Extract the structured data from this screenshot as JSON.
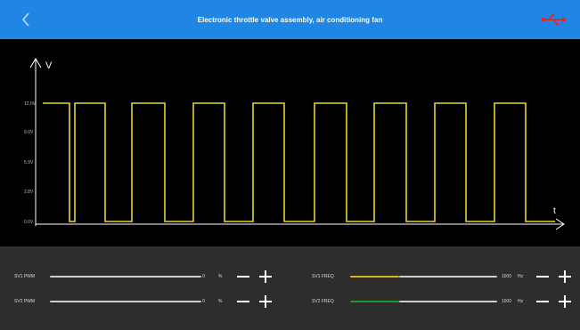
{
  "header": {
    "title": "Electronic throttle valve assembly, air conditioning fan"
  },
  "icons": {
    "back": "chevron-left-icon",
    "usb": "usb-icon"
  },
  "colors": {
    "header": "#1f86e3",
    "waveform": "#e6d52a",
    "sv2_freq_track": "#1e9a2a"
  },
  "chart_data": {
    "type": "line",
    "title": "",
    "xlabel": "t",
    "ylabel": "V",
    "y_ticks": [
      "0.0V",
      "2.8V",
      "5.9V",
      "9.0V",
      "12.0V"
    ],
    "ylim": [
      0,
      12
    ],
    "grid": false,
    "series": [
      {
        "values_description": "square wave toggling between 0 and 12 V, 9 high pulses",
        "x": [
          0,
          30,
          30,
          36,
          36,
          70,
          70,
          100,
          100,
          137,
          137,
          169,
          169,
          204,
          204,
          236,
          236,
          271,
          271,
          305,
          305,
          341,
          341,
          372,
          372,
          408,
          408,
          440,
          440,
          475,
          475,
          507,
          507,
          542,
          542,
          575
        ],
        "y": [
          12,
          12,
          0,
          0,
          12,
          12,
          0,
          0,
          12,
          12,
          0,
          0,
          12,
          12,
          0,
          0,
          12,
          12,
          0,
          0,
          12,
          12,
          0,
          0,
          12,
          12,
          0,
          0,
          12,
          12,
          0,
          0,
          12,
          12,
          0,
          0
        ]
      }
    ]
  },
  "controls": {
    "sv1_pwm": {
      "label": "SV1 PWM",
      "value": "0",
      "unit": "%"
    },
    "sv2_pwm": {
      "label": "SV2 PWM",
      "value": "0",
      "unit": "%"
    },
    "sv1_freq": {
      "label": "SV1 FREQ",
      "value": "1000",
      "unit": "Hz"
    },
    "sv2_freq": {
      "label": "SV2 FREQ",
      "value": "1000",
      "unit": "Hz"
    }
  }
}
